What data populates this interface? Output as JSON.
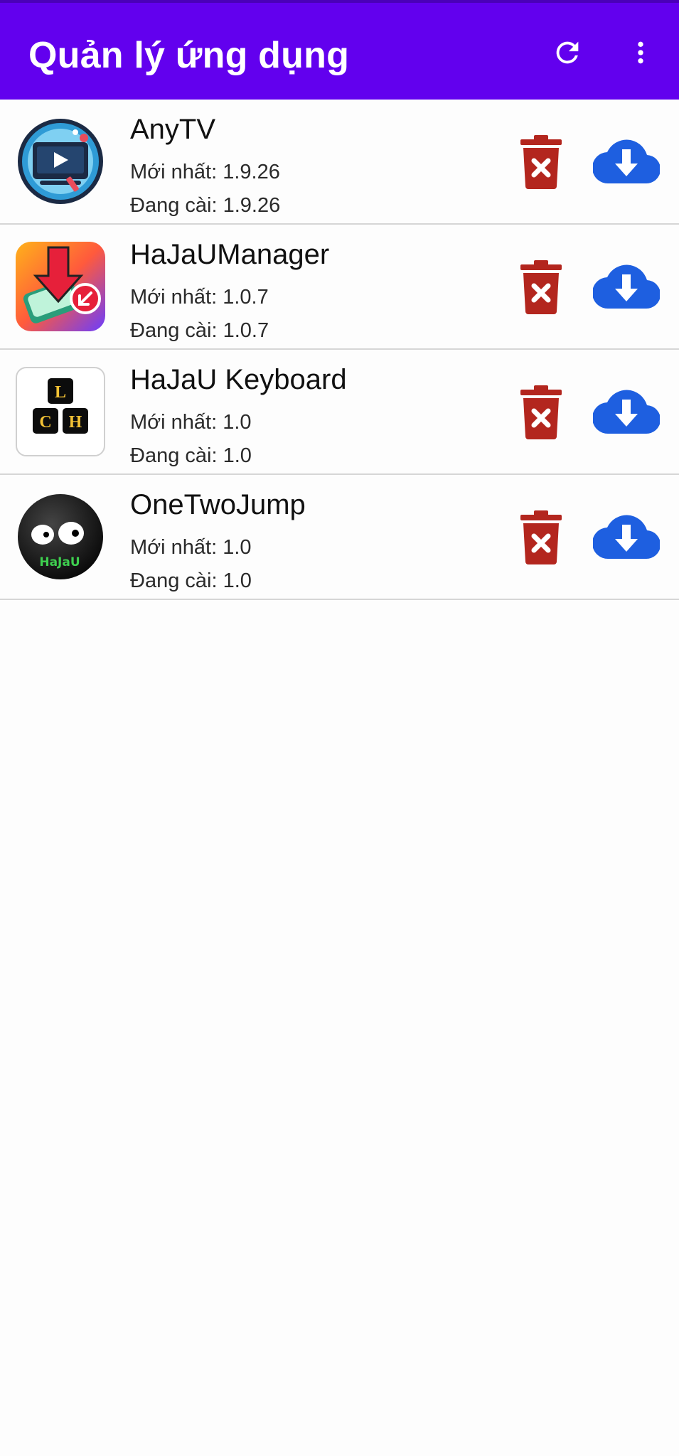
{
  "appbar": {
    "title": "Quản lý ứng dụng",
    "refresh_icon": "refresh-icon",
    "more_icon": "more-vertical-icon",
    "color": "#6200ee"
  },
  "labels": {
    "latest_prefix": "Mới nhất: ",
    "installed_prefix": "Đang cài: "
  },
  "apps": [
    {
      "name": "AnyTV",
      "latest": "Mới nhất: 1.9.26",
      "installed": "Đang cài: 1.9.26",
      "icon": "tv-player-app-icon"
    },
    {
      "name": "HaJaUManager",
      "latest": "Mới nhất: 1.0.7",
      "installed": "Đang cài: 1.0.7",
      "icon": "download-manager-app-icon"
    },
    {
      "name": "HaJaU Keyboard",
      "latest": "Mới nhất: 1.0",
      "installed": "Đang cài: 1.0",
      "icon": "keyboard-app-icon",
      "icon_keys": [
        "L",
        "C",
        "H"
      ]
    },
    {
      "name": "OneTwoJump",
      "latest": "Mới nhất: 1.0",
      "installed": "Đang cài: 1.0",
      "icon": "jump-game-app-icon",
      "icon_text": "HaJaU"
    }
  ],
  "actions": {
    "delete_icon": "trash-delete-icon",
    "delete_color": "#b3261e",
    "download_icon": "cloud-download-icon",
    "download_color": "#1e5fe0"
  }
}
